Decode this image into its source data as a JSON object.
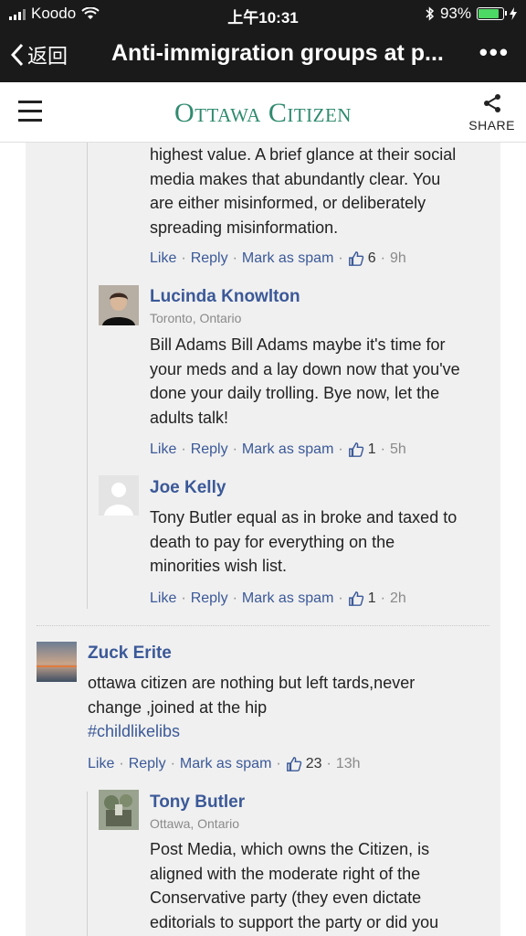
{
  "status_bar": {
    "carrier": "Koodo",
    "time": "上午10:31",
    "battery": "93%",
    "battery_level": 0.93
  },
  "nav": {
    "back_label": "返回",
    "title": "Anti-immigration groups at p...",
    "more": "•••"
  },
  "site": {
    "logo": "Ottawa Citizen",
    "share_label": "SHARE"
  },
  "comments": [
    {
      "text_lines": [
        "highest value. A brief glance at their social",
        "media makes that abundantly clear. You",
        "are either misinformed, or deliberately",
        "spreading misinformation."
      ],
      "actions": {
        "like": "Like",
        "reply": "Reply",
        "spam": "Mark as spam",
        "likes": "6",
        "time": "9h"
      }
    },
    {
      "author": "Lucinda Knowlton",
      "location": "Toronto, Ontario",
      "text_lines": [
        "Bill Adams Bill Adams maybe it's time for",
        "your meds and a lay down now that you've",
        "done your daily trolling. Bye now, let the",
        "adults talk!"
      ],
      "actions": {
        "like": "Like",
        "reply": "Reply",
        "spam": "Mark as spam",
        "likes": "1",
        "time": "5h"
      }
    },
    {
      "author": "Joe Kelly",
      "text_lines": [
        "Tony Butler equal as in broke and taxed to",
        "death to pay for everything on the",
        "minorities wish list."
      ],
      "actions": {
        "like": "Like",
        "reply": "Reply",
        "spam": "Mark as spam",
        "likes": "1",
        "time": "2h"
      }
    },
    {
      "author": "Zuck Erite",
      "text_lines": [
        "ottawa citizen are nothing but left tards,never",
        "change ,joined at the hip"
      ],
      "hashtag": "#childlikelibs",
      "actions": {
        "like": "Like",
        "reply": "Reply",
        "spam": "Mark as spam",
        "likes": "23",
        "time": "13h"
      }
    },
    {
      "author": "Tony Butler",
      "location": "Ottawa, Ontario",
      "text_lines": [
        "Post Media, which owns the Citizen, is",
        "aligned with the moderate right of the",
        "Conservative party (they even dictate",
        "editorials to support the party or did you"
      ]
    }
  ]
}
